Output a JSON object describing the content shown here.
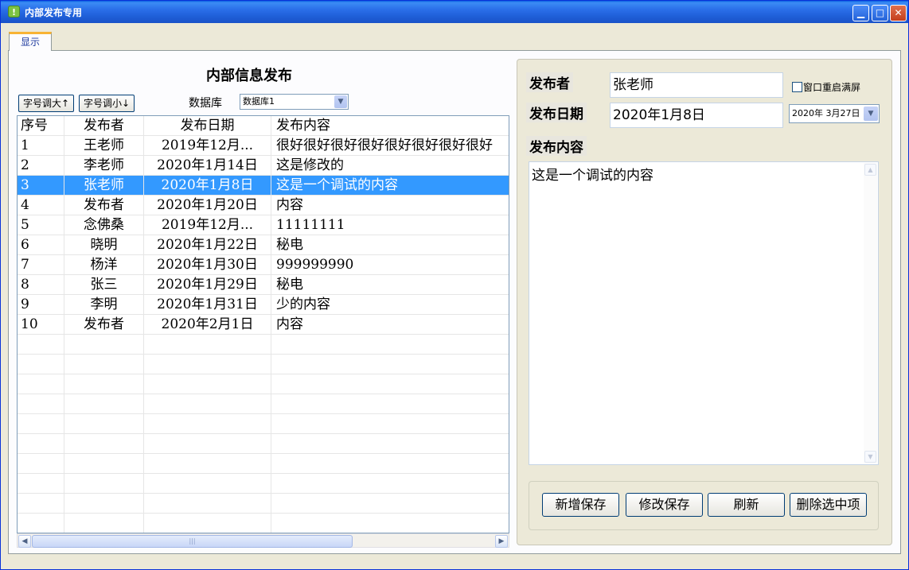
{
  "window": {
    "title": "内部发布专用",
    "icon": "app-icon",
    "min_glyph": "▁",
    "max_glyph": "□",
    "close_glyph": "✕"
  },
  "tabs": [
    {
      "label": "显示",
      "active": true
    }
  ],
  "left": {
    "title": "内部信息发布",
    "font_up_label": "字号调大↑",
    "font_down_label": "字号调小↓",
    "db_label": "数据库",
    "db_selected": "数据库1"
  },
  "grid": {
    "columns": [
      "序号",
      "发布者",
      "发布日期",
      "发布内容"
    ],
    "rows": [
      [
        "1",
        "王老师",
        "2019年12月...",
        "很好很好很好很好很好很好很好很好"
      ],
      [
        "2",
        "李老师",
        "2020年1月14日",
        "这是修改的"
      ],
      [
        "3",
        "张老师",
        "2020年1月8日",
        "这是一个调试的内容"
      ],
      [
        "4",
        "发布者",
        "2020年1月20日",
        "内容"
      ],
      [
        "5",
        "念佛桑",
        "2019年12月...",
        "11111111"
      ],
      [
        "6",
        "晓明",
        "2020年1月22日",
        "秘电"
      ],
      [
        "7",
        "杨洋",
        "2020年1月30日",
        "999999990"
      ],
      [
        "8",
        "张三",
        "2020年1月29日",
        "秘电"
      ],
      [
        "9",
        "李明",
        "2020年1月31日",
        "少的内容"
      ],
      [
        "10",
        "发布者",
        "2020年2月1日",
        "内容"
      ]
    ],
    "selected_index": 2,
    "scroll_left": "◀",
    "scroll_right": "▶",
    "scroll_thumb": "|||"
  },
  "right": {
    "publisher_label": "发布者",
    "publisher_value": "张老师",
    "fullscreen_label": "窗口重启满屏",
    "date_label": "发布日期",
    "date_value": "2020年1月8日",
    "date_picker_value": "2020年 3月27日",
    "content_label": "发布内容",
    "content_value": "这是一个调试的内容",
    "scroll_up": "▲",
    "scroll_down": "▼"
  },
  "actions": {
    "add_label": "新增保存",
    "edit_label": "修改保存",
    "refresh_label": "刷新",
    "delete_label": "删除选中项"
  },
  "colors": {
    "selection": "#3399ff",
    "titlebar": "#1f5fd8"
  }
}
